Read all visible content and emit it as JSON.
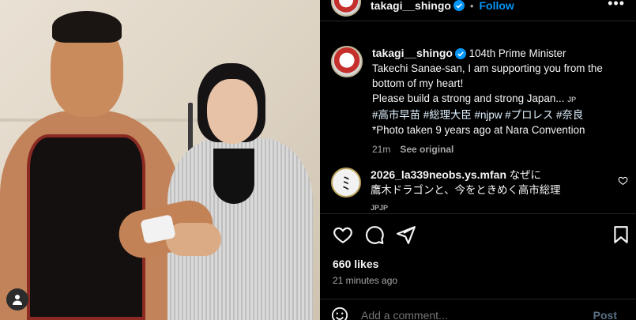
{
  "colors": {
    "background": "#000000",
    "accent": "#0095f6",
    "muted": "#a8a8a8",
    "divider": "#262626",
    "hashtag": "#e0f1ff"
  },
  "photo": {
    "icon": "user-tag-icon"
  },
  "header": {
    "username": "takagi__shingo",
    "separator": "•",
    "follow_label": "Follow",
    "more_label": "•••"
  },
  "caption": {
    "username": "takagi__shingo",
    "line1": " 104th Prime Minister",
    "line2": "Takechi Sanae-san, I am supporting you from the",
    "line3": "bottom of my heart!",
    "line4": "Please build a strong and strong Japan...",
    "line4_lang": "JP",
    "hashtags": [
      "#高市早苗",
      "#総理大臣",
      "#njpw",
      "#プロレス",
      "#奈良"
    ],
    "line6": "*Photo taken 9 years ago at Nara Convention",
    "time": "21m",
    "see_original": "See original"
  },
  "comment": {
    "username": "2026_la339neobs.ys.mfan",
    "text1": " なぜに",
    "text2": "鷹木ドラゴンと、今をときめく高市総理",
    "lang": "JPJP",
    "avatar_glyph": "ﾐ"
  },
  "actions": {
    "icons": [
      "heart-icon",
      "comment-icon",
      "share-icon",
      "bookmark-icon"
    ]
  },
  "likes": "660 likes",
  "timestamp": "21 minutes ago",
  "add_comment": {
    "placeholder": "Add a comment...",
    "post_label": "Post"
  }
}
